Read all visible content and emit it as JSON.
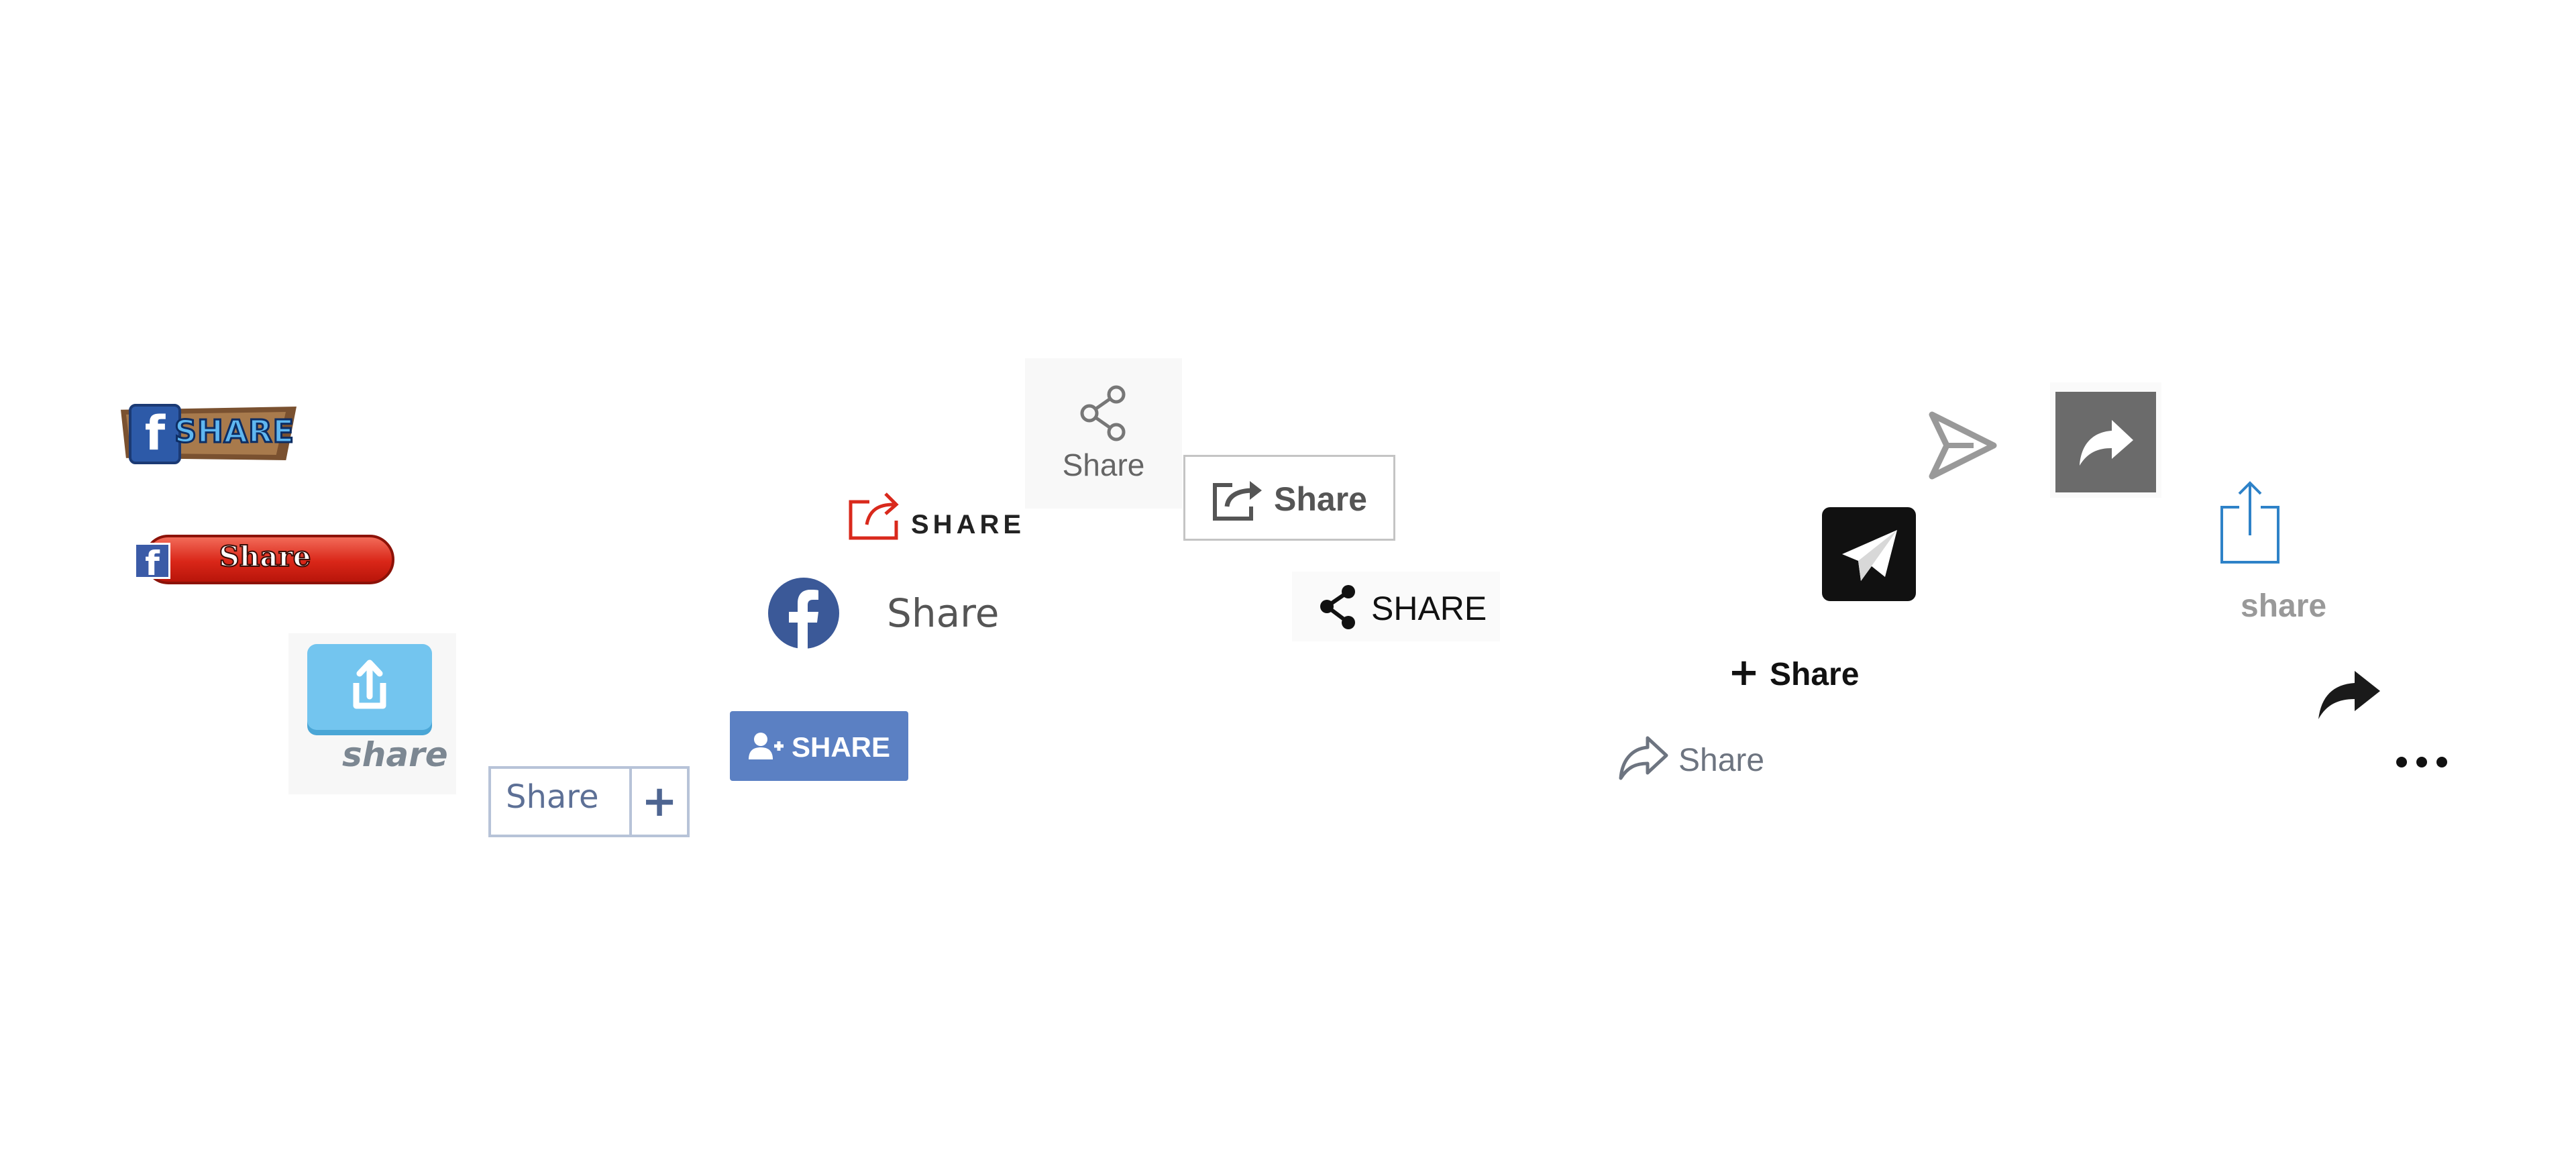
{
  "buttons": {
    "fb_wood": {
      "label": "SHARE",
      "icon": "facebook-f-icon",
      "colors": {
        "badge": "#2d5aa8",
        "text": "#5fb7f0",
        "plank": "#a87a4c"
      }
    },
    "fb_red_pill": {
      "label": "Share",
      "icon": "facebook-f-icon",
      "colors": {
        "pill": "#d92618"
      }
    },
    "blue_share_box": {
      "label": "share",
      "icon": "share-box-icon",
      "colors": {
        "box": "#73c5ef"
      }
    },
    "share_plus": {
      "label": "Share",
      "plus": "+",
      "colors": {
        "border": "#b7c3d8",
        "text": "#5d7096"
      }
    },
    "blue_person_share": {
      "label": "SHARE",
      "icon": "person-icon",
      "colors": {
        "bg": "#5b80c3"
      }
    },
    "fb_circle_share": {
      "label": "Share",
      "icon": "facebook-circle-icon",
      "colors": {
        "circle": "#3b5998"
      }
    },
    "red_outline_share": {
      "label": "SHARE",
      "icon": "share-out-icon",
      "colors": {
        "icon": "#d9291c"
      }
    },
    "nodes_share": {
      "label": "Share",
      "icon": "share-nodes-icon"
    },
    "outlined_share": {
      "label": "Share",
      "icon": "share-square-icon"
    },
    "nodes_share_caps": {
      "label": "SHARE",
      "icon": "share-nodes-icon"
    },
    "plus_share": {
      "label": "Share",
      "plus": "+"
    },
    "reply_share": {
      "label": "Share",
      "icon": "forward-outline-icon"
    },
    "black_plane": {
      "icon": "paper-plane-icon",
      "colors": {
        "bg": "#111111"
      }
    },
    "send_outline": {
      "icon": "send-icon",
      "colors": {
        "stroke": "#999999"
      }
    },
    "grey_forward": {
      "icon": "forward-arrow-icon",
      "colors": {
        "bg": "#6b6b6b"
      }
    },
    "ios_share": {
      "label": "share",
      "icon": "ios-share-icon",
      "colors": {
        "icon": "#2e82c8"
      }
    },
    "black_forward": {
      "icon": "forward-arrow-icon"
    },
    "more": {
      "icon": "more-dots-icon"
    }
  }
}
